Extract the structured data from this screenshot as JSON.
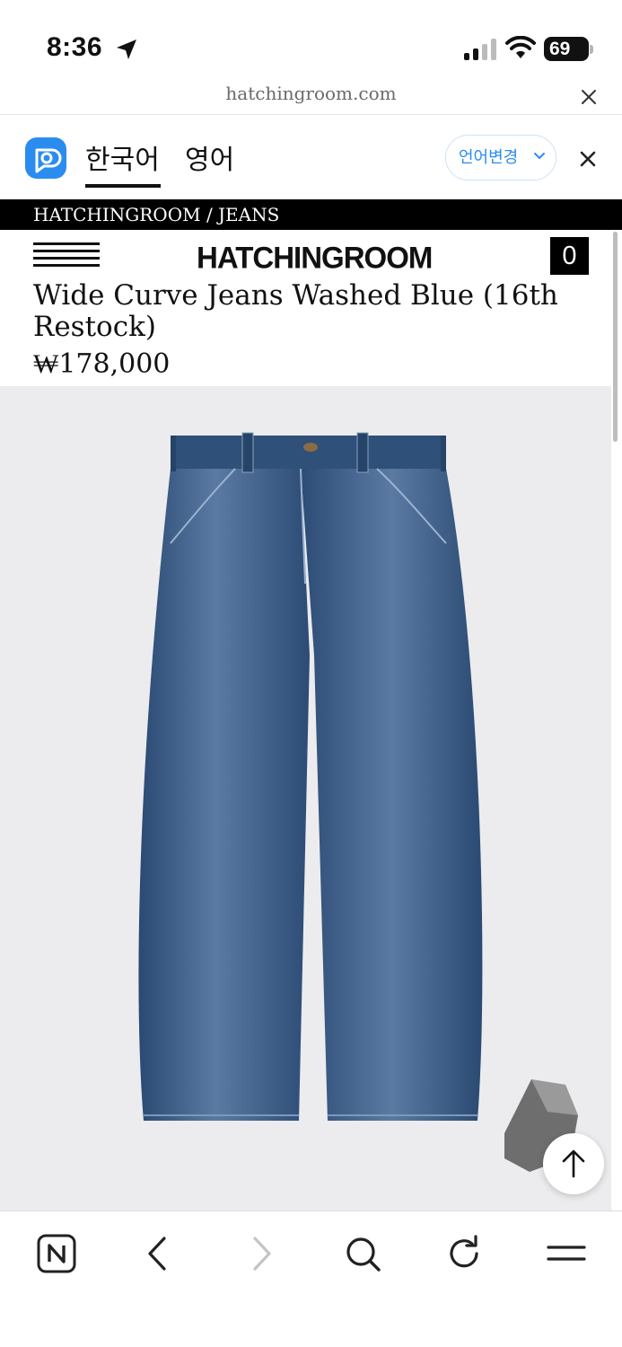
{
  "status_bar": {
    "time": "8:36",
    "battery": "69"
  },
  "browser": {
    "url": "hatchingroom.com"
  },
  "translate_bar": {
    "tabs": [
      {
        "label": "한국어",
        "active": true
      },
      {
        "label": "영어",
        "active": false
      }
    ],
    "change_language_label": "언어변경"
  },
  "site": {
    "breadcrumb": "HATCHINGROOM / JEANS",
    "logo": "HATCHINGROOM",
    "cart_count": "0"
  },
  "product": {
    "title": "Wide Curve Jeans Washed Blue (16th Restock)",
    "price": "₩178,000"
  },
  "colors": {
    "accent": "#2b8cf0",
    "image_background": "#ececee",
    "denim": "#2f4f78"
  },
  "icons": {
    "bottom_toolbar": [
      "naver-home-icon",
      "back-icon",
      "forward-icon",
      "search-icon",
      "refresh-icon",
      "menu-icon"
    ]
  }
}
